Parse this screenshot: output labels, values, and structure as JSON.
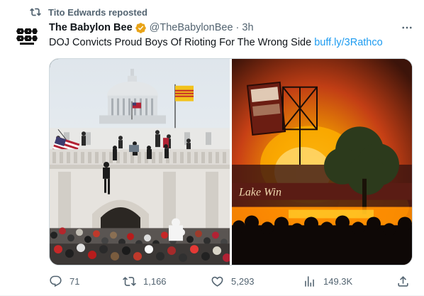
{
  "repost_banner": {
    "text": "Tito Edwards reposted",
    "icon": "repost-icon"
  },
  "author": {
    "name": "The Babylon Bee",
    "handle": "@TheBabylonBee",
    "separator": "·",
    "time": "3h",
    "verified_icon": "verified-badge-icon",
    "verified_color": "#e8a317",
    "avatar_color": "#111111"
  },
  "tweet": {
    "text": "DOJ Convicts Proud Boys Of Rioting For The Wrong Side",
    "link": "buff.ly/3Rathco",
    "link_color": "#1d9bf0"
  },
  "media": {
    "left_image": "capitol-crowd-photo",
    "right_image": "burning-building-photo",
    "right_sign_text": "Lake Win"
  },
  "actions": {
    "replies": "71",
    "reposts": "1,166",
    "likes": "5,293",
    "views": "149.3K"
  }
}
